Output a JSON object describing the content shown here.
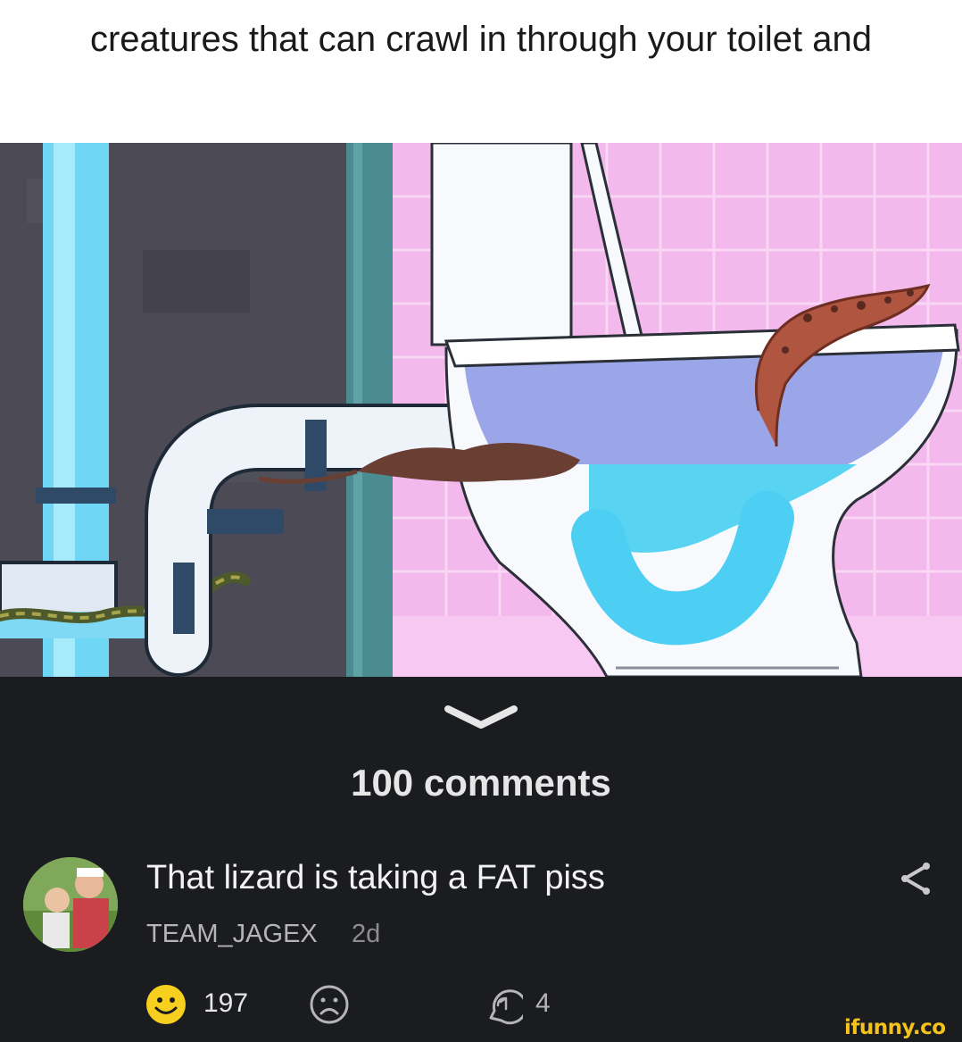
{
  "post": {
    "caption": "creatures that can crawl in through your toilet and"
  },
  "comments_section": {
    "count_label": "100 comments"
  },
  "comment": {
    "text": "That lizard is taking a FAT piss",
    "author": "TEAM_JAGEX",
    "age": "2d",
    "smiles": "197",
    "replies": "4"
  },
  "watermark": "ifunny.co",
  "colors": {
    "background": "#1b1c20",
    "smile_yellow": "#f6cf1f",
    "watermark_yellow": "#f4c21a",
    "wall_dark": "#4b4a55",
    "tiles_pink": "#f3b8ec",
    "water_blue": "#56d3f2"
  },
  "icons": {
    "chevron": "chevron-down-icon",
    "share": "share-icon",
    "smile": "smile-icon",
    "unsmile": "unsmile-icon",
    "reply": "reply-icon"
  }
}
